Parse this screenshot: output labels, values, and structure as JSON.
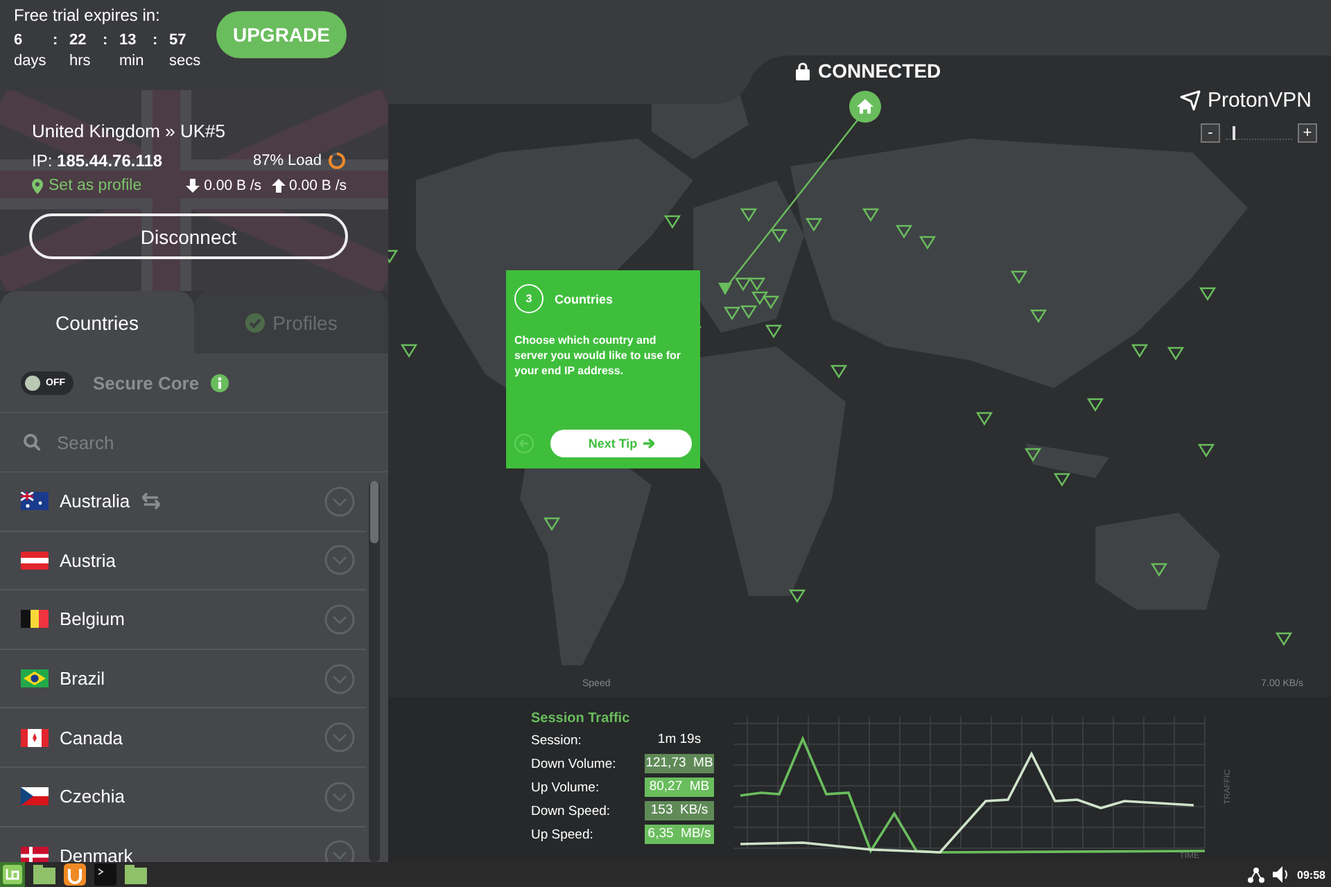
{
  "trial": {
    "title": "Free trial expires in:",
    "countdown": [
      {
        "value": "6",
        "unit": "days"
      },
      {
        "value": "22",
        "unit": "hrs"
      },
      {
        "value": "13",
        "unit": "min"
      },
      {
        "value": "57",
        "unit": "secs"
      }
    ],
    "separators": [
      ":",
      ":",
      ":"
    ],
    "upgrade_button": "UPGRADE"
  },
  "connection": {
    "server": "United Kingdom » UK#5",
    "ip": "IP: **185.44.76.118**",
    "load": {
      "text": "87% Load",
      "level": 0.87
    },
    "set_profile": "Set as profile",
    "download": "0.00 B /s",
    "upload": "0.00 B /s",
    "disconnect_button": "Disconnect"
  },
  "tabs": [
    {
      "label": "Countries",
      "selected": true
    },
    {
      "label": "Profiles",
      "selected": false
    }
  ],
  "secure_core": {
    "toggle_text": "OFF",
    "on": false,
    "label": "Secure Core"
  },
  "search": {
    "placeholder": "Search"
  },
  "countries": [
    {
      "name": "Australia",
      "arrows_icon": true
    },
    {
      "name": "Austria",
      "arrows_icon": false
    },
    {
      "name": "Belgium",
      "arrows_icon": false
    },
    {
      "name": "Brazil",
      "arrows_icon": false
    },
    {
      "name": "Canada",
      "arrows_icon": false
    },
    {
      "name": "Czechia",
      "arrows_icon": false
    },
    {
      "name": "Denmark",
      "arrows_icon": false
    }
  ],
  "map": {
    "status": "CONNECTED",
    "brand": "ProtonVPN",
    "zoom_out": "-",
    "zoom_in": "+",
    "zoom": {
      "level": 0.1
    },
    "speed_label": "Speed",
    "speed_max": "7.00 KB/s"
  },
  "tip": {
    "step": "3",
    "title": "Countries",
    "text": "Choose which country and server you would like to use for your end IP address.",
    "next_button": "Next Tip"
  },
  "traffic": {
    "title": "Session Traffic",
    "rows": [
      {
        "label": "Session:",
        "value": "1m 19s",
        "kind": "plain"
      },
      {
        "label": "Down Volume:",
        "value": "121,73  MB",
        "kind": "down"
      },
      {
        "label": "Up Volume:",
        "value": "80,27  MB",
        "kind": "up"
      },
      {
        "label": "Down Speed:",
        "value": "153  KB/s",
        "kind": "down"
      },
      {
        "label": "Up Speed:",
        "value": "6,35  MB/s",
        "kind": "up"
      }
    ],
    "y_axis": "TRAFFIC",
    "x_axis": "TIME"
  },
  "taskbar": {
    "clock": "09:58"
  }
}
